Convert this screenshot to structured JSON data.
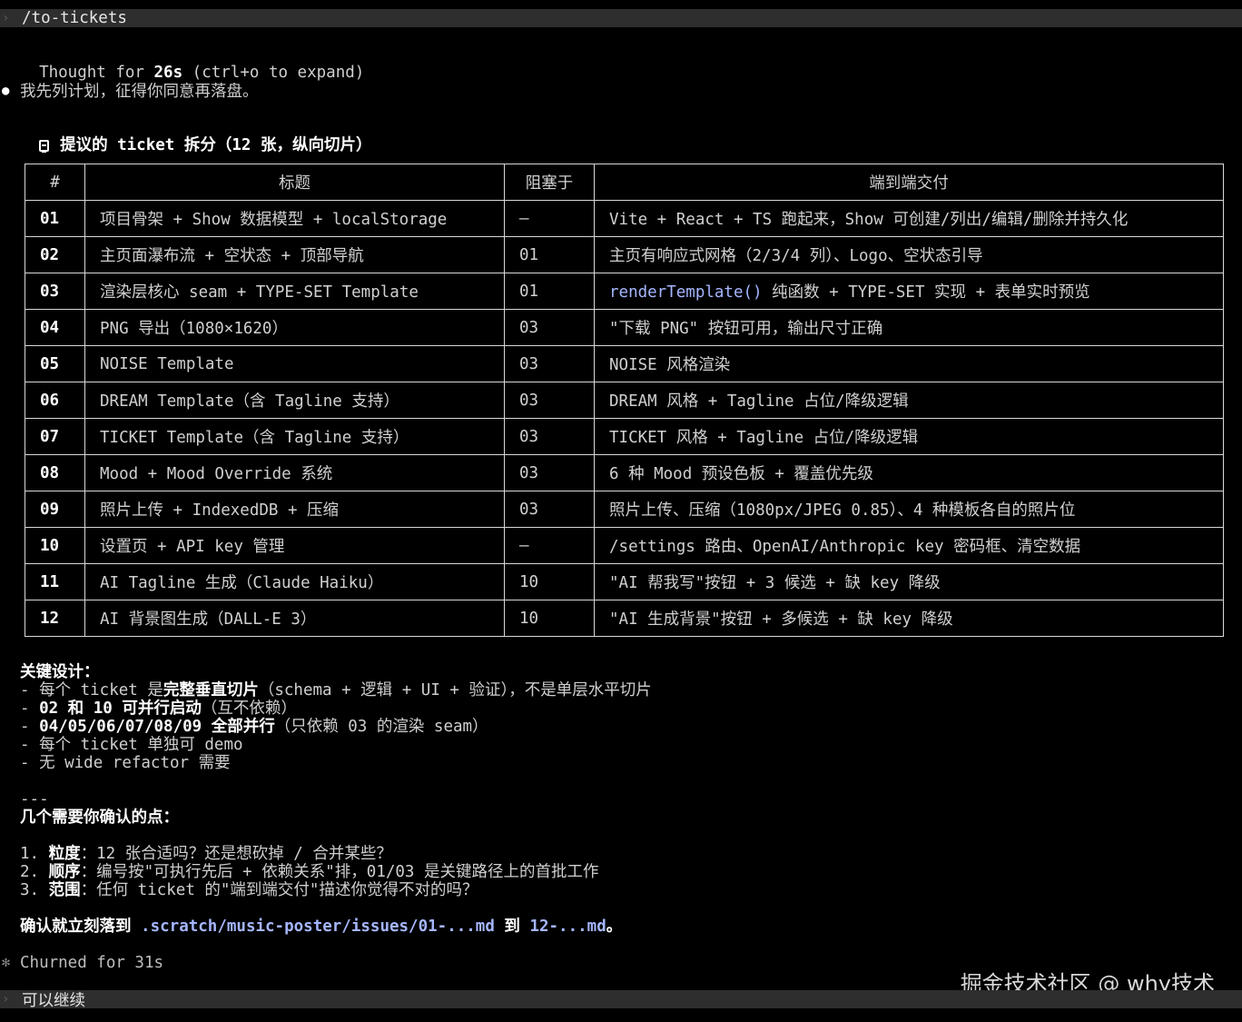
{
  "command": "/to-tickets",
  "thought": {
    "prefix": "Thought for ",
    "duration": "26s",
    "suffix": " (ctrl+o to expand)"
  },
  "intro": "我先列计划，征得你同意再落盘。",
  "section_title": "提议的 ticket 拆分（12 张，纵向切片）",
  "table": {
    "headers": [
      "#",
      "标题",
      "阻塞于",
      "端到端交付"
    ],
    "rows": [
      {
        "id": "01",
        "title": "项目骨架 + Show 数据模型 + localStorage",
        "blocked": "—",
        "delivery": "Vite + React + TS 跑起来，Show 可创建/列出/编辑/删除并持久化"
      },
      {
        "id": "02",
        "title": "主页面瀑布流 + 空状态 + 顶部导航",
        "blocked": "01",
        "delivery": "主页有响应式网格（2/3/4 列）、Logo、空状态引导"
      },
      {
        "id": "03",
        "title": "渲染层核心 seam + TYPE-SET Template",
        "blocked": "01",
        "delivery_code": "renderTemplate()",
        "delivery": " 纯函数 + TYPE-SET 实现 + 表单实时预览"
      },
      {
        "id": "04",
        "title": "PNG 导出（1080×1620）",
        "blocked": "03",
        "delivery": "\"下载 PNG\" 按钮可用，输出尺寸正确"
      },
      {
        "id": "05",
        "title": "NOISE Template",
        "blocked": "03",
        "delivery": "NOISE 风格渲染"
      },
      {
        "id": "06",
        "title": "DREAM Template（含 Tagline 支持）",
        "blocked": "03",
        "delivery": "DREAM 风格 + Tagline 占位/降级逻辑"
      },
      {
        "id": "07",
        "title": "TICKET Template（含 Tagline 支持）",
        "blocked": "03",
        "delivery": "TICKET 风格 + Tagline 占位/降级逻辑"
      },
      {
        "id": "08",
        "title": "Mood + Mood Override 系统",
        "blocked": "03",
        "delivery": "6 种 Mood 预设色板 + 覆盖优先级"
      },
      {
        "id": "09",
        "title": "照片上传 + IndexedDB + 压缩",
        "blocked": "03",
        "delivery": "照片上传、压缩（1080px/JPEG 0.85）、4 种模板各自的照片位"
      },
      {
        "id": "10",
        "title": "设置页 + API key 管理",
        "blocked": "—",
        "delivery": "/settings 路由、OpenAI/Anthropic key 密码框、清空数据"
      },
      {
        "id": "11",
        "title": "AI Tagline 生成（Claude Haiku）",
        "blocked": "10",
        "delivery": "\"AI 帮我写\"按钮 + 3 候选 + 缺 key 降级"
      },
      {
        "id": "12",
        "title": "AI 背景图生成（DALL-E 3）",
        "blocked": "10",
        "delivery": "\"AI 生成背景\"按钮 + 多候选 + 缺 key 降级"
      }
    ]
  },
  "key_design": {
    "title": "关键设计：",
    "l1_a": "- 每个 ticket 是",
    "l1_b": "完整垂直切片",
    "l1_c": "（schema + 逻辑 + UI + 验证），不是单层水平切片",
    "l2_a": "- ",
    "l2_b": "02 和 10 可并行启动",
    "l2_c": "（互不依赖）",
    "l3_a": "- ",
    "l3_b": "04/05/06/07/08/09 全部并行",
    "l3_c": "（只依赖 03 的渲染 seam）",
    "l4": "- 每个 ticket 单独可 demo",
    "l5": "- 无 wide refactor 需要"
  },
  "separator": "---",
  "confirm_title": "几个需要你确认的点：",
  "points": {
    "p1_n": "1. ",
    "p1_b": "粒度",
    "p1_t": "：12 张合适吗？还是想砍掉 / 合并某些？",
    "p2_n": "2. ",
    "p2_b": "顺序",
    "p2_t": "：编号按\"可执行先后 + 依赖关系\"排，01/03 是关键路径上的首批工作",
    "p3_n": "3. ",
    "p3_b": "范围",
    "p3_t": "：任何 ticket 的\"端到端交付\"描述你觉得不对的吗？"
  },
  "final": {
    "a": "确认就立刻落到 ",
    "path1": ".scratch/music-poster/issues/01-...md",
    "b": " 到 ",
    "path2": "12-...md",
    "c": "。"
  },
  "churned": "Churned for 31s",
  "user_input": "可以继续",
  "watermark": "掘金技术社区 @ why技术"
}
